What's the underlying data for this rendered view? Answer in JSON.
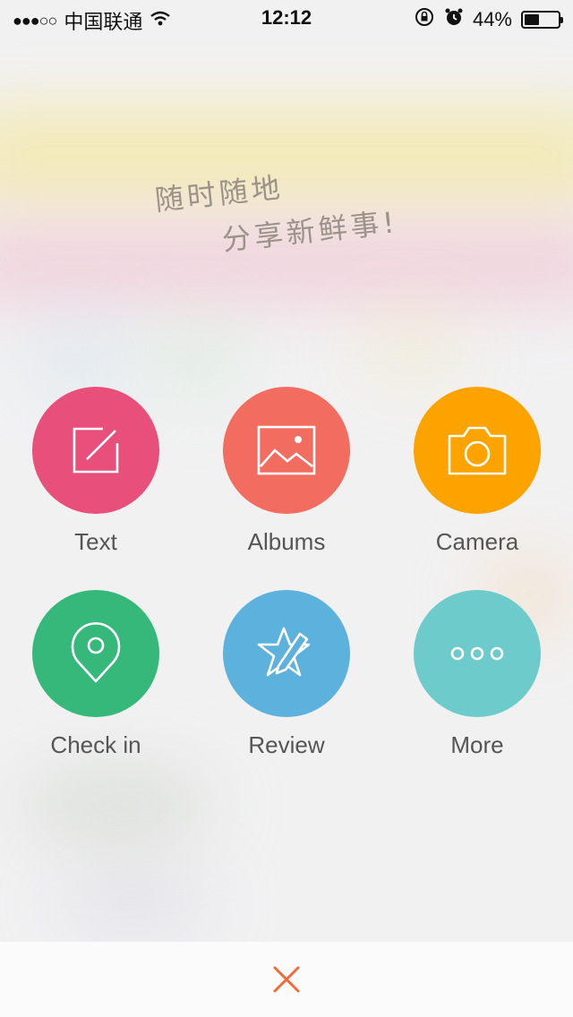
{
  "status_bar": {
    "signal": "●●●○○",
    "carrier": "中国联通",
    "time": "12:12",
    "battery_percent": "44%",
    "battery_level": 0.44
  },
  "slogan": {
    "line1": "随时随地",
    "line2": "分享新鲜事!"
  },
  "actions": [
    {
      "label": "Text",
      "icon": "compose-icon",
      "color": "#e8507b"
    },
    {
      "label": "Albums",
      "icon": "image-icon",
      "color": "#f26d5f"
    },
    {
      "label": "Camera",
      "icon": "camera-icon",
      "color": "#fda300"
    },
    {
      "label": "Check in",
      "icon": "location-pin-icon",
      "color": "#36b87b"
    },
    {
      "label": "Review",
      "icon": "star-pen-icon",
      "color": "#5cb2dc"
    },
    {
      "label": "More",
      "icon": "more-dots-icon",
      "color": "#6dcccb"
    }
  ],
  "bottom_bar": {
    "close_icon": "close-icon",
    "close_color": "#f06a3a"
  }
}
